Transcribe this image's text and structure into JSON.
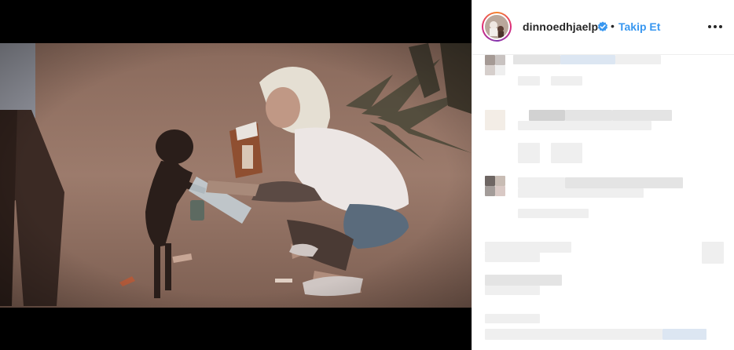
{
  "post": {
    "username": "dinnoedhjaelp",
    "verified": true,
    "separator": "•",
    "follow_label": "Takip Et",
    "more_icon": "more-horizontal-icon",
    "verified_icon": "verified-badge-icon"
  },
  "colors": {
    "accent": "#3897f0",
    "text": "#262626",
    "media_bg": "#000000"
  },
  "media": {
    "type": "photo",
    "icon": "post-image"
  },
  "comments": {
    "state": "pixelated"
  }
}
